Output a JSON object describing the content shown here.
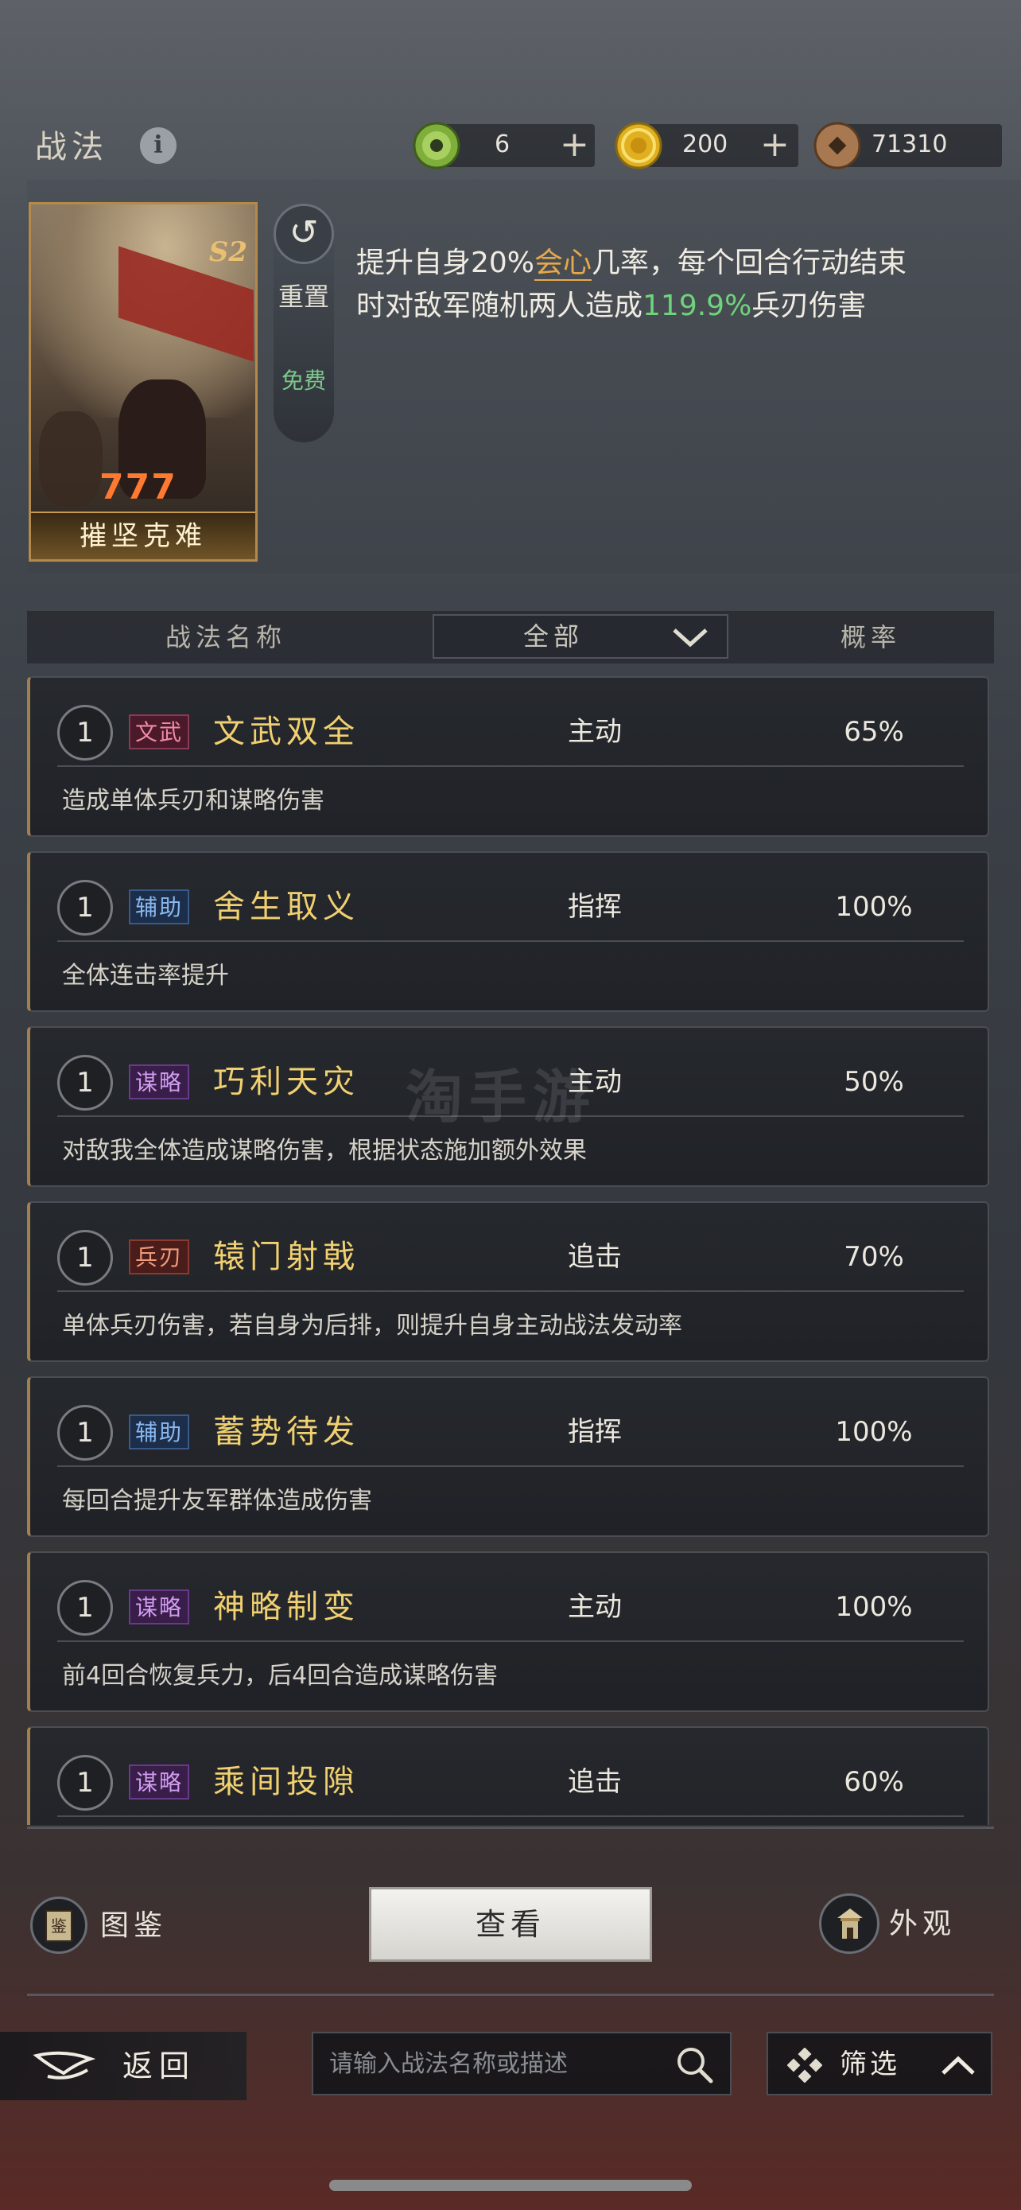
{
  "header": {
    "title": "战法",
    "currencies": [
      {
        "icon": "jade-coin-icon",
        "value": "6",
        "has_plus": true
      },
      {
        "icon": "gold-coin-icon",
        "value": "200",
        "has_plus": true
      },
      {
        "icon": "copper-coin-icon",
        "value": "71310",
        "has_plus": false
      }
    ]
  },
  "selected_skill": {
    "card_name": "摧坚克难",
    "season_badge": "S2",
    "pips": "777",
    "reset_label": "重置",
    "free_label": "免费",
    "description": {
      "part1": "提升自身20%",
      "highlight": "会心",
      "part2": "几率，每个回合行动结束时对敌军随机两人造成",
      "green": "119.9%",
      "part3": "兵刃伤害"
    }
  },
  "table_header": {
    "name_col": "战法名称",
    "filter_value": "全部",
    "rate_col": "概率"
  },
  "skills": [
    {
      "level": "1",
      "tag": "文武",
      "tag_class": "tag-wenwu",
      "name": "文武双全",
      "type": "主动",
      "rate": "65%",
      "desc": "造成单体兵刃和谋略伤害"
    },
    {
      "level": "1",
      "tag": "辅助",
      "tag_class": "tag-fuzhu",
      "name": "舍生取义",
      "type": "指挥",
      "rate": "100%",
      "desc": "全体连击率提升"
    },
    {
      "level": "1",
      "tag": "谋略",
      "tag_class": "tag-moulue",
      "name": "巧利天灾",
      "type": "主动",
      "rate": "50%",
      "desc": "对敌我全体造成谋略伤害，根据状态施加额外效果"
    },
    {
      "level": "1",
      "tag": "兵刃",
      "tag_class": "tag-bingren",
      "name": "辕门射戟",
      "type": "追击",
      "rate": "70%",
      "desc": "单体兵刃伤害，若自身为后排，则提升自身主动战法发动率"
    },
    {
      "level": "1",
      "tag": "辅助",
      "tag_class": "tag-fuzhu",
      "name": "蓄势待发",
      "type": "指挥",
      "rate": "100%",
      "desc": "每回合提升友军群体造成伤害"
    },
    {
      "level": "1",
      "tag": "谋略",
      "tag_class": "tag-moulue",
      "name": "神略制变",
      "type": "主动",
      "rate": "100%",
      "desc": "前4回合恢复兵力，后4回合造成谋略伤害"
    },
    {
      "level": "1",
      "tag": "谋略",
      "tag_class": "tag-moulue",
      "name": "乘间投隙",
      "type": "追击",
      "rate": "60%",
      "desc": ""
    }
  ],
  "watermark": "淘手游",
  "bottom": {
    "tujian_label": "图鉴",
    "tujian_icon_text": "鉴",
    "view_label": "查看",
    "waiguan_label": "外观",
    "back_label": "返回",
    "search_placeholder": "请输入战法名称或描述",
    "filter_label": "筛选"
  }
}
